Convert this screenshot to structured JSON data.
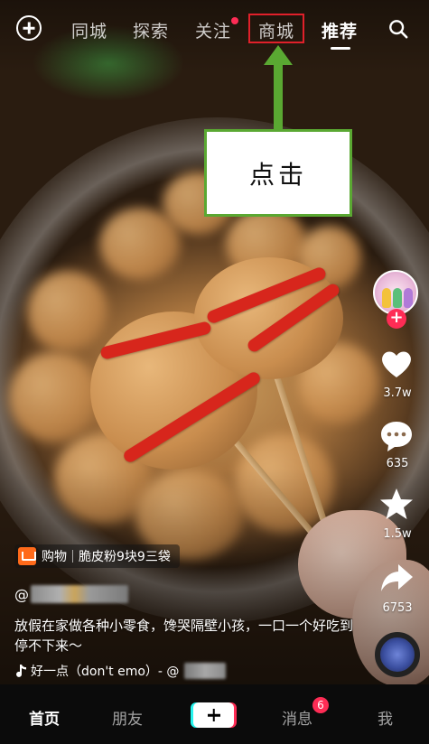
{
  "top_nav": {
    "tabs": [
      {
        "label": "同城"
      },
      {
        "label": "探索"
      },
      {
        "label": "关注",
        "has_dot": true
      },
      {
        "label": "商城",
        "highlighted": true
      },
      {
        "label": "推荐",
        "active": true
      }
    ],
    "icons": [
      "add-circle-icon",
      "search-icon"
    ]
  },
  "annotation": {
    "callout_text": "点击",
    "arrow_color": "#5aa832",
    "highlight_color": "#e0202a"
  },
  "right_rail": {
    "like_count": "3.7w",
    "comment_count": "635",
    "favorite_count": "1.5w",
    "share_count": "6753",
    "icons": [
      "avatar",
      "follow-plus-icon",
      "heart-icon",
      "comment-icon",
      "star-icon",
      "share-icon",
      "music-disc"
    ]
  },
  "video_info": {
    "shop_badge": {
      "label": "购物",
      "product": "脆皮粉9块9三袋"
    },
    "username_prefix": "@",
    "description": "放假在家做各种小零食，馋哭隔壁小孩，一口一个好吃到停不下来～",
    "music": "好一点（don't emo）- @"
  },
  "bottom_tabs": {
    "home": "首页",
    "friends": "朋友",
    "messages": "消息",
    "messages_badge": "6",
    "me": "我"
  },
  "colors": {
    "accent": "#fe2c55",
    "cyan": "#25f4ee",
    "shop_orange": "#ff6a1a"
  }
}
